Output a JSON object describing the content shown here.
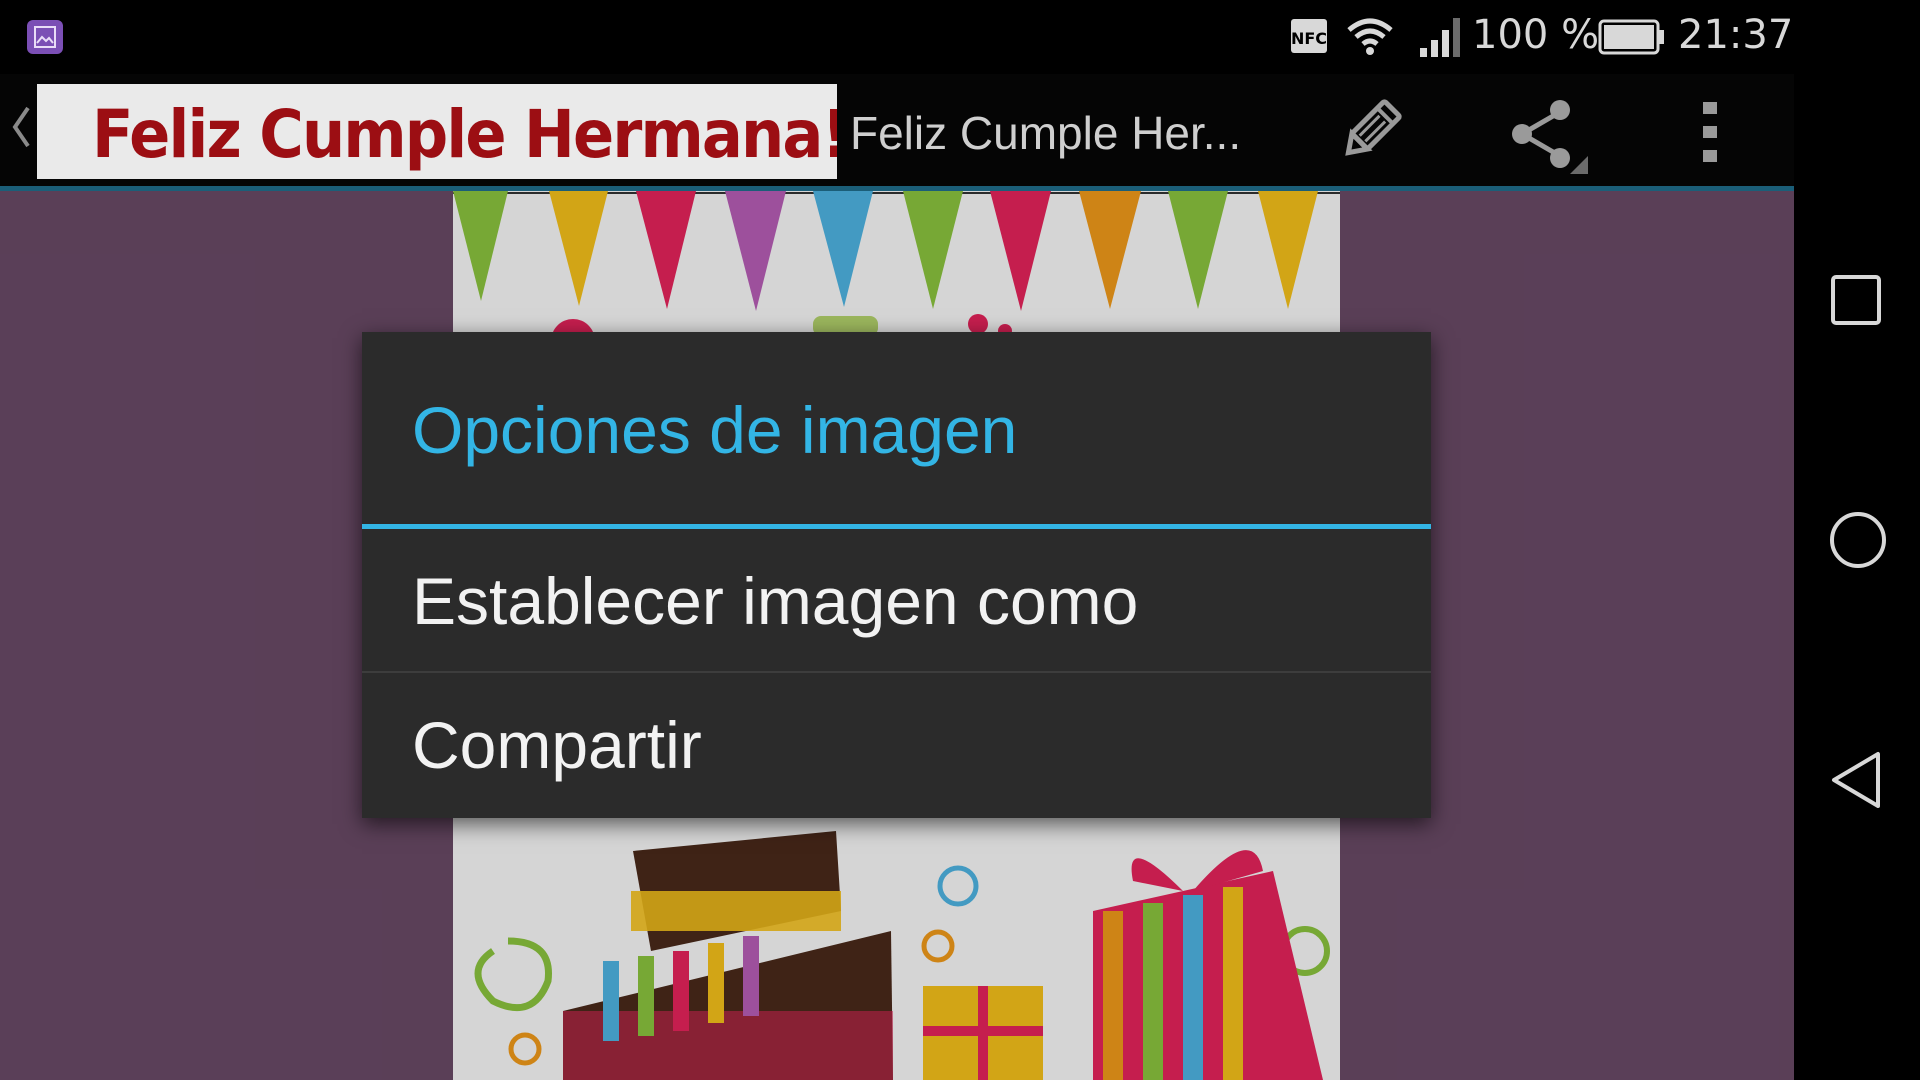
{
  "status_bar": {
    "notification_icon": "image-icon",
    "nfc_label": "NFC",
    "battery_percent": "100 %",
    "battery_level": 1.0,
    "time": "21:37",
    "signal_icon": "signal-icon",
    "wifi_icon": "wifi-icon"
  },
  "action_bar": {
    "back_icon": "chevron-left-icon",
    "banner_text": "Feliz Cumple Hermana!",
    "title": "Feliz Cumple Her...",
    "actions": [
      "edit-icon",
      "share-icon",
      "overflow-menu-icon"
    ]
  },
  "content": {
    "background_color": "#6a4a67",
    "image_description_icon": "birthday-card-image"
  },
  "dialog": {
    "title": "Opciones de imagen",
    "accent_color": "#33b5e5",
    "items": [
      {
        "label": "Establecer imagen como"
      },
      {
        "label": "Compartir"
      }
    ]
  },
  "nav_bar": {
    "buttons": [
      "recent-apps-icon",
      "home-icon",
      "back-icon"
    ]
  }
}
